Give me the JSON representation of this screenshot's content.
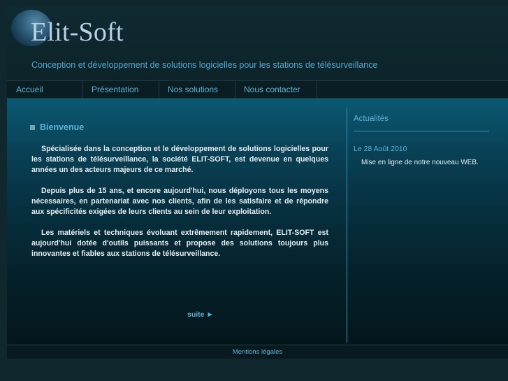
{
  "header": {
    "logo_text": "Elit-Soft",
    "tagline": "Conception et développement de solutions logicielles pour les stations de télésurveillance"
  },
  "nav": {
    "items": [
      {
        "label": "Accueil"
      },
      {
        "label": "Présentation"
      },
      {
        "label": "Nos solutions"
      },
      {
        "label": "Nous contacter"
      }
    ]
  },
  "main": {
    "title": "Bienvenue",
    "paragraphs": [
      "Spécialisée dans la conception et le développement de solutions logicielles pour les stations de télésurveillance, la société ELIT-SOFT, est devenue en quelques années un des acteurs majeurs de ce marché.",
      "Depuis plus de 15 ans, et encore aujourd'hui, nous déployons tous les moyens nécessaires, en partenariat avec nos clients, afin de les satisfaire et de répondre aux spécificités exigées de leurs clients au sein de leur exploitation.",
      "Les matériels et techniques évoluant extrêmement rapidement, ELIT-SOFT est aujourd'hui dotée d'outils puissants et propose des solutions toujours plus innovantes et fiables aux stations de télésurveillance."
    ],
    "more_label": "suite ►"
  },
  "news": {
    "title": "Actualités",
    "date": "Le 28 Août 2010",
    "text": "Mise en ligne de notre nouveau WEB."
  },
  "footer": {
    "legal_label": "Mentions légales"
  },
  "colors": {
    "accent": "#5bb2d6",
    "background": "#10272e"
  }
}
